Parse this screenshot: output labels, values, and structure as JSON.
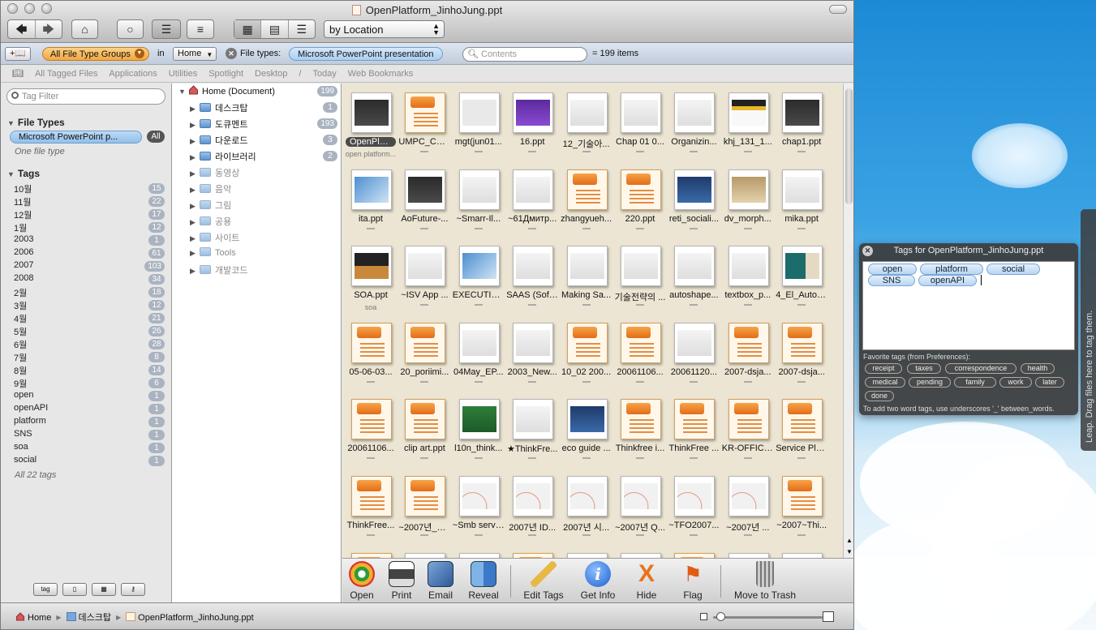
{
  "window": {
    "title": "OpenPlatform_JinhoJung.ppt"
  },
  "toolbar": {
    "sort_select": "by Location"
  },
  "filterbar": {
    "add_label": "+📖",
    "group_token": "All File Type Groups",
    "in_label": "in",
    "location": "Home",
    "filetype_label": "File types:",
    "filetype_token": "Microsoft PowerPoint presentation",
    "search_placeholder": "Contents",
    "result": "= 199 items"
  },
  "bookmarks": [
    "All Tagged Files",
    "Applications",
    "Utilities",
    "Spotlight",
    "Desktop",
    "/",
    "Today",
    "Web Bookmarks"
  ],
  "sidebar": {
    "tag_filter_placeholder": "Tag Filter",
    "file_types_header": "File Types",
    "file_type_selected": "Microsoft PowerPoint p...",
    "all_badge": "All",
    "one_file_type": "One file type",
    "tags_header": "Tags",
    "tags": [
      [
        "10월",
        "15"
      ],
      [
        "11월",
        "22"
      ],
      [
        "12월",
        "17"
      ],
      [
        "1월",
        "12"
      ],
      [
        "2003",
        "1"
      ],
      [
        "2006",
        "61"
      ],
      [
        "2007",
        "103"
      ],
      [
        "2008",
        "34"
      ],
      [
        "2월",
        "18"
      ],
      [
        "3월",
        "12"
      ],
      [
        "4월",
        "21"
      ],
      [
        "5월",
        "26"
      ],
      [
        "6월",
        "28"
      ],
      [
        "7월",
        "8"
      ],
      [
        "8월",
        "14"
      ],
      [
        "9월",
        "6"
      ],
      [
        "open",
        "1"
      ],
      [
        "openAPI",
        "1"
      ],
      [
        "platform",
        "1"
      ],
      [
        "SNS",
        "1"
      ],
      [
        "soa",
        "1"
      ],
      [
        "social",
        "1"
      ]
    ],
    "all_tags": "All 22 tags",
    "bottom_buttons": [
      "tag",
      "",
      "",
      ""
    ]
  },
  "tree": {
    "root": {
      "label": "Home (Document)",
      "count": "199"
    },
    "items": [
      [
        "데스크탑",
        "1",
        false
      ],
      [
        "도큐멘트",
        "193",
        false
      ],
      [
        "다운로드",
        "3",
        false
      ],
      [
        "라이브러리",
        "2",
        false
      ],
      [
        "동영상",
        "",
        true
      ],
      [
        "음악",
        "",
        true
      ],
      [
        "그림",
        "",
        true
      ],
      [
        "공용",
        "",
        true
      ],
      [
        "사이트",
        "",
        true
      ],
      [
        "Tools",
        "",
        true
      ],
      [
        "개발코드",
        "",
        true
      ]
    ]
  },
  "files": [
    {
      "name": "OpenPlatfo...",
      "sub": "open platform...",
      "kind": "dark",
      "sel": true
    },
    {
      "name": "UMPC_CES...",
      "kind": "ppt"
    },
    {
      "name": "mgt(jun01...",
      "kind": "gray"
    },
    {
      "name": "16.ppt",
      "kind": "purple"
    },
    {
      "name": "12_기술아...",
      "kind": "light"
    },
    {
      "name": "Chap 01 0...",
      "kind": "light"
    },
    {
      "name": "Organizin...",
      "kind": "light"
    },
    {
      "name": "khj_131_1...",
      "kind": "yellow"
    },
    {
      "name": "chap1.ppt",
      "kind": "dark"
    },
    {
      "name": "ita.ppt",
      "kind": "blue"
    },
    {
      "name": "AoFuture-...",
      "kind": "dark"
    },
    {
      "name": "~Smarr-Il...",
      "kind": "light"
    },
    {
      "name": "~61Дмитр...",
      "kind": "light"
    },
    {
      "name": "zhangyueh...",
      "kind": "ppt"
    },
    {
      "name": "220.ppt",
      "kind": "ppt"
    },
    {
      "name": "reti_sociali...",
      "kind": "navy"
    },
    {
      "name": "dv_morph...",
      "kind": "tan"
    },
    {
      "name": "mika.ppt",
      "kind": "light"
    },
    {
      "name": "SOA.ppt",
      "sub": "soa",
      "kind": "night"
    },
    {
      "name": "~ISV App ...",
      "kind": "light"
    },
    {
      "name": "EXECUTIN...",
      "kind": "blue"
    },
    {
      "name": "SAAS (Soft...",
      "kind": "light"
    },
    {
      "name": "Making Sa...",
      "kind": "light"
    },
    {
      "name": "기술전략의 ...",
      "kind": "light"
    },
    {
      "name": "autoshape...",
      "kind": "light"
    },
    {
      "name": "textbox_p...",
      "kind": "light"
    },
    {
      "name": "4_El_Autoe...",
      "kind": "teal"
    },
    {
      "name": "05-06-03...",
      "kind": "ppt"
    },
    {
      "name": "20_poriimi...",
      "kind": "ppt"
    },
    {
      "name": "04May_EP...",
      "kind": "light"
    },
    {
      "name": "2003_New...",
      "kind": "light"
    },
    {
      "name": "10_02 200...",
      "kind": "ppt"
    },
    {
      "name": "20061106...",
      "kind": "ppt"
    },
    {
      "name": "20061120...",
      "kind": "light"
    },
    {
      "name": "2007-dsja...",
      "kind": "ppt"
    },
    {
      "name": "2007-dsja...",
      "kind": "ppt"
    },
    {
      "name": "20061106...",
      "kind": "ppt"
    },
    {
      "name": "clip art.ppt",
      "kind": "ppt"
    },
    {
      "name": "l10n_think...",
      "kind": "green"
    },
    {
      "name": "★ThinkFre...",
      "kind": "light"
    },
    {
      "name": "eco guide ...",
      "kind": "navy"
    },
    {
      "name": "Thinkfree i...",
      "kind": "ppt"
    },
    {
      "name": "ThinkFree ...",
      "kind": "ppt"
    },
    {
      "name": "KR-OFFICE...",
      "kind": "ppt"
    },
    {
      "name": "Service Pla...",
      "kind": "ppt"
    },
    {
      "name": "ThinkFree...",
      "kind": "ppt"
    },
    {
      "name": "~2007년_N...",
      "kind": "ppt"
    },
    {
      "name": "~Smb servi...",
      "kind": "arc"
    },
    {
      "name": "2007년 ID...",
      "kind": "arc"
    },
    {
      "name": "2007년 시...",
      "kind": "arc"
    },
    {
      "name": "~2007년 Q...",
      "kind": "arc"
    },
    {
      "name": "~TFO2007...",
      "kind": "arc"
    },
    {
      "name": "~2007년 ...",
      "kind": "arc"
    },
    {
      "name": "~2007~Thi...",
      "kind": "ppt"
    }
  ],
  "actions": [
    "Open",
    "Print",
    "Email",
    "Reveal",
    "Edit Tags",
    "Get Info",
    "Hide",
    "Flag",
    "Move to Trash"
  ],
  "statusbar": {
    "crumbs": [
      "Home",
      "데스크탑",
      "OpenPlatform_JinhoJung.ppt"
    ]
  },
  "tag_panel": {
    "title": "Tags for OpenPlatform_JinhoJung.ppt",
    "tags": [
      "open",
      "platform",
      "social",
      "SNS",
      "openAPI"
    ],
    "fav_label": "Favorite tags (from Preferences):",
    "favorites": [
      "receipt",
      "taxes",
      "correspondence",
      "health",
      "medical",
      "pending",
      "family",
      "work",
      "later",
      "done"
    ],
    "hint": "To add two word tags, use underscores '_' between_words."
  },
  "leap_drawer": "Leap. Drag files here to tag them.",
  "colors": {
    "accent_blue": "#6e9fd0",
    "orange_token": "#f3a640",
    "grid_bg": "#ece5d3",
    "badge": "#aab3c0"
  }
}
